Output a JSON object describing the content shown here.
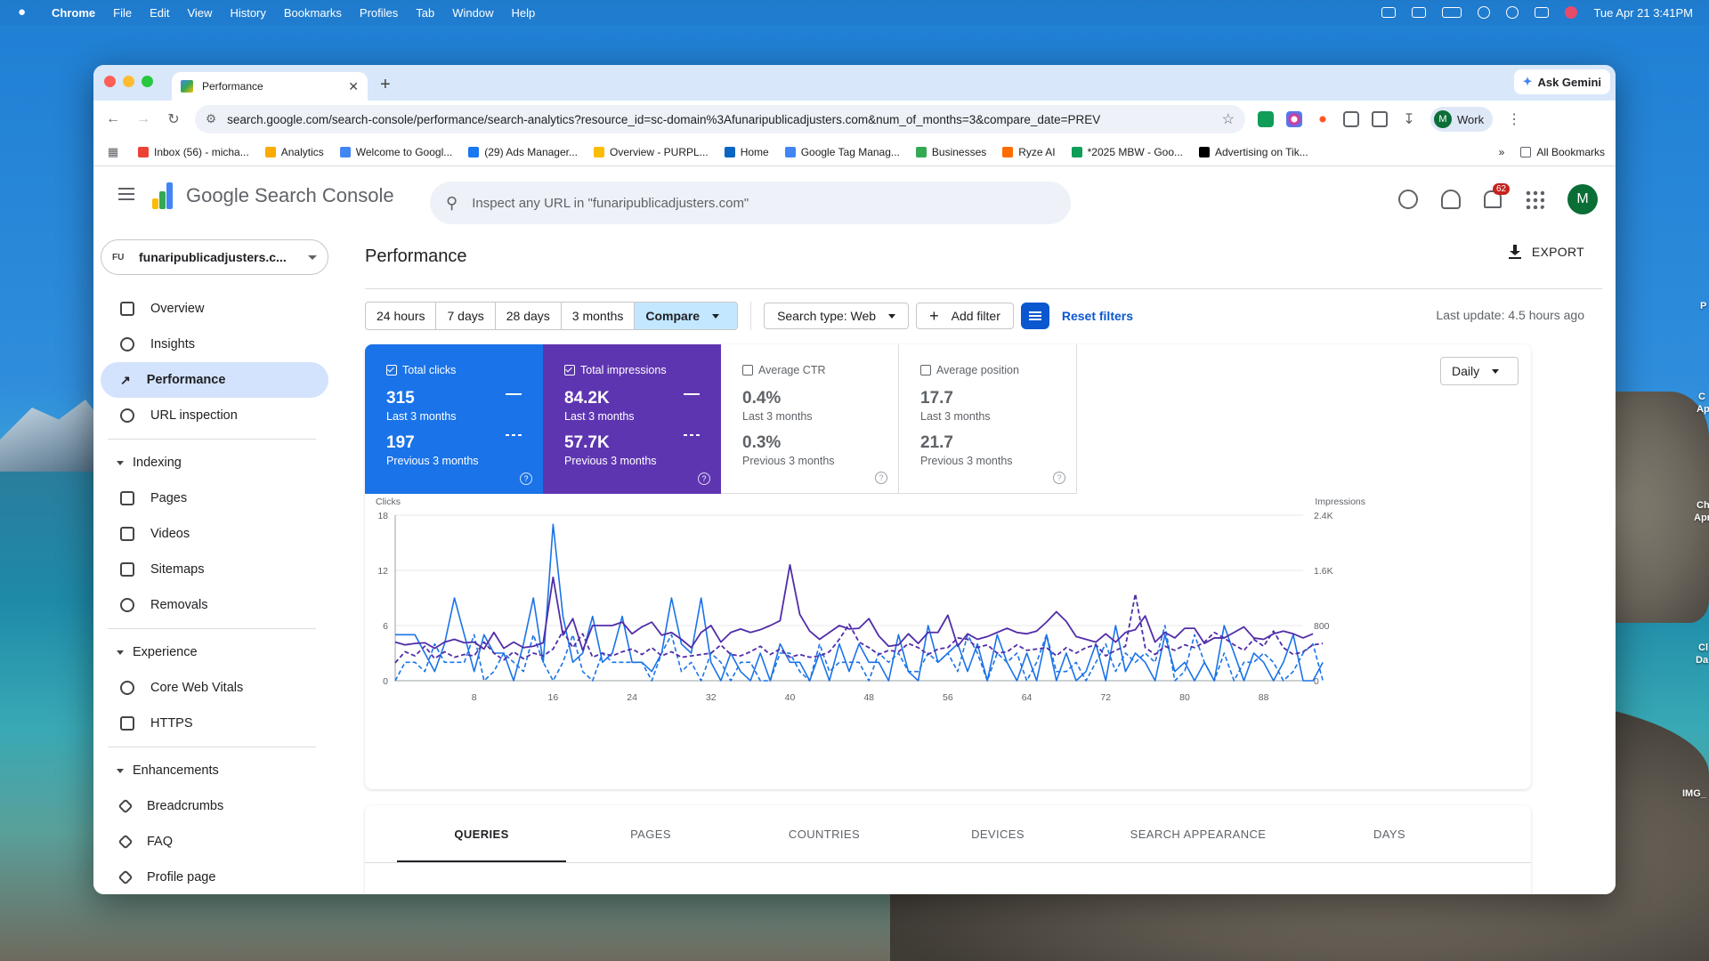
{
  "menubar": {
    "app": "Chrome",
    "items": [
      "File",
      "Edit",
      "View",
      "History",
      "Bookmarks",
      "Profiles",
      "Tab",
      "Window",
      "Help"
    ],
    "datetime": "Tue Apr 21  3:41PM"
  },
  "browser": {
    "tab_title": "Performance",
    "gemini": "Ask Gemini",
    "url": "search.google.com/search-console/performance/search-analytics?resource_id=sc-domain%3Afunaripublicadjusters.com&num_of_months=3&compare_date=PREV",
    "profile_initial": "M",
    "profile_label": "Work",
    "bookmarks": [
      {
        "label": "Inbox (56) - micha...",
        "color": "#ea4335"
      },
      {
        "label": "Analytics",
        "color": "#f9ab00"
      },
      {
        "label": "Welcome to Googl...",
        "color": "#4285f4"
      },
      {
        "label": "(29) Ads Manager...",
        "color": "#1877f2"
      },
      {
        "label": "Overview - PURPL...",
        "color": "#fbbc05"
      },
      {
        "label": "Home",
        "color": "#0a66c2"
      },
      {
        "label": "Google Tag Manag...",
        "color": "#4285f4"
      },
      {
        "label": "Businesses",
        "color": "#34a853"
      },
      {
        "label": "Ryze AI",
        "color": "#ff6d00"
      },
      {
        "label": "*2025 MBW - Goo...",
        "color": "#0f9d58"
      },
      {
        "label": "Advertising on Tik...",
        "color": "#000000"
      }
    ],
    "all_bookmarks": "All Bookmarks"
  },
  "app": {
    "product_name": "Google Search Console",
    "search_placeholder": "Inspect any URL in \"funaripublicadjusters.com\"",
    "notifications_count": "62",
    "avatar_initial": "M"
  },
  "sidebar": {
    "property_prefix": "FU",
    "property": "funaripublicadjusters.c...",
    "top_items": [
      "Overview",
      "Insights",
      "Performance",
      "URL inspection"
    ],
    "sections": [
      {
        "title": "Indexing",
        "items": [
          "Pages",
          "Videos",
          "Sitemaps",
          "Removals"
        ]
      },
      {
        "title": "Experience",
        "items": [
          "Core Web Vitals",
          "HTTPS"
        ]
      },
      {
        "title": "Enhancements",
        "items": [
          "Breadcrumbs",
          "FAQ",
          "Profile page"
        ]
      }
    ]
  },
  "main": {
    "title": "Performance",
    "export": "EXPORT",
    "date_ranges": [
      "24 hours",
      "7 days",
      "28 days",
      "3 months"
    ],
    "compare": "Compare",
    "search_type": "Search type: Web",
    "add_filter": "Add filter",
    "reset_filters": "Reset filters",
    "last_update": "Last update: 4.5 hours ago",
    "granularity": "Daily"
  },
  "metrics": [
    {
      "label": "Total clicks",
      "current": "315",
      "current_period": "Last 3 months",
      "previous": "197",
      "previous_period": "Previous 3 months",
      "checked": true,
      "color": "#1a73e8"
    },
    {
      "label": "Total impressions",
      "current": "84.2K",
      "current_period": "Last 3 months",
      "previous": "57.7K",
      "previous_period": "Previous 3 months",
      "checked": true,
      "color": "#5e35b1"
    },
    {
      "label": "Average CTR",
      "current": "0.4%",
      "current_period": "Last 3 months",
      "previous": "0.3%",
      "previous_period": "Previous 3 months",
      "checked": false
    },
    {
      "label": "Average position",
      "current": "17.7",
      "current_period": "Last 3 months",
      "previous": "21.7",
      "previous_period": "Previous 3 months",
      "checked": false
    }
  ],
  "chart_data": {
    "type": "line",
    "left_axis_label": "Clicks",
    "right_axis_label": "Impressions",
    "left_ticks": [
      "0",
      "6",
      "12",
      "18"
    ],
    "right_ticks": [
      "0",
      "800",
      "1.6K",
      "2.4K"
    ],
    "x_ticks": [
      "8",
      "16",
      "24",
      "32",
      "40",
      "48",
      "56",
      "64",
      "72",
      "80",
      "88"
    ],
    "ylim_left": [
      0,
      18
    ],
    "ylim_right": [
      0,
      2400
    ],
    "xlim": [
      0,
      92
    ],
    "grid": true,
    "legend": "none",
    "series": [
      {
        "axis": "left",
        "color": "#1a73e8",
        "style": "solid",
        "values": [
          5,
          5,
          5,
          3,
          1,
          4,
          9,
          5,
          1,
          5,
          3,
          3,
          0,
          4,
          9,
          2,
          17,
          7,
          2,
          3,
          7,
          2,
          3,
          7,
          2,
          2,
          1,
          3,
          9,
          4,
          3,
          9,
          2,
          0,
          3,
          1,
          0,
          3,
          0,
          4,
          2,
          2,
          0,
          3,
          0,
          4,
          1,
          4,
          2,
          2,
          0,
          5,
          1,
          0,
          6,
          2,
          3,
          4,
          1,
          4,
          0,
          5,
          2,
          0,
          3,
          0,
          5,
          0,
          3,
          0,
          1,
          4,
          0,
          6,
          1,
          3,
          2,
          0,
          5,
          1,
          2,
          0,
          2,
          0,
          6,
          3,
          0,
          3,
          2,
          0,
          2,
          5,
          0,
          0,
          2
        ]
      },
      {
        "axis": "left",
        "color": "#1a73e8",
        "style": "dashed",
        "values": [
          0,
          2,
          2,
          1,
          4,
          2,
          2,
          2,
          5,
          0,
          1,
          3,
          2,
          1,
          5,
          2,
          0,
          2,
          5,
          1,
          0,
          3,
          2,
          2,
          2,
          2,
          0,
          3,
          5,
          1,
          2,
          0,
          3,
          2,
          0,
          2,
          2,
          0,
          0,
          3,
          3,
          1,
          0,
          4,
          1,
          2,
          2,
          2,
          0,
          3,
          2,
          3,
          1,
          1,
          3,
          2,
          3,
          1,
          5,
          3,
          0,
          3,
          2,
          3,
          0,
          2,
          5,
          1,
          1,
          2,
          0,
          2,
          4,
          1,
          3,
          2,
          3,
          2,
          6,
          0,
          1,
          5,
          2,
          0,
          3,
          0,
          2,
          2,
          3,
          2,
          0,
          1,
          3,
          4,
          0
        ]
      },
      {
        "axis": "right",
        "color": "#512da8",
        "style": "solid",
        "values": [
          560,
          520,
          540,
          550,
          470,
          560,
          600,
          550,
          560,
          460,
          700,
          470,
          560,
          480,
          500,
          550,
          1500,
          660,
          900,
          440,
          800,
          800,
          800,
          850,
          680,
          780,
          850,
          660,
          700,
          600,
          480,
          700,
          800,
          560,
          700,
          750,
          700,
          740,
          800,
          870,
          1680,
          960,
          720,
          600,
          700,
          800,
          750,
          760,
          900,
          650,
          500,
          520,
          680,
          540,
          700,
          700,
          950,
          500,
          680,
          600,
          640,
          700,
          760,
          700,
          680,
          720,
          850,
          1000,
          860,
          640,
          600,
          560,
          680,
          560,
          700,
          740,
          940,
          560,
          700,
          620,
          760,
          760,
          540,
          620,
          620,
          700,
          780,
          620,
          600,
          680,
          720,
          680,
          620,
          680
        ]
      },
      {
        "axis": "right",
        "color": "#512da8",
        "style": "dashed",
        "values": [
          260,
          420,
          360,
          500,
          320,
          420,
          340,
          380,
          360,
          560,
          400,
          300,
          420,
          320,
          400,
          360,
          460,
          720,
          480,
          680,
          340,
          400,
          360,
          420,
          460,
          380,
          480,
          360,
          420,
          340,
          360,
          380,
          400,
          520,
          380,
          360,
          420,
          500,
          380,
          460,
          340,
          380,
          340,
          360,
          420,
          600,
          820,
          560,
          480,
          380,
          440,
          420,
          540,
          480,
          380,
          460,
          480,
          620,
          600,
          480,
          520,
          400,
          420,
          520,
          440,
          460,
          480,
          360,
          480,
          400,
          480,
          520,
          360,
          440,
          500,
          1260,
          480,
          380,
          500,
          440,
          520,
          480,
          560,
          700,
          620,
          520,
          440,
          600,
          500,
          720,
          480,
          380,
          420,
          520,
          540
        ]
      }
    ]
  },
  "table_tabs": [
    "QUERIES",
    "PAGES",
    "COUNTRIES",
    "DEVICES",
    "SEARCH APPEARANCE",
    "DAYS"
  ],
  "desktop_labels": [
    "P",
    "C",
    "Ap",
    "Ch",
    "Apr",
    "Cl",
    "Da",
    "IMG_"
  ],
  "colors": {
    "clicks": "#1a73e8",
    "impressions": "#5e35b1",
    "accent": "#0b57d0",
    "nav_active": "#d3e3fd"
  }
}
